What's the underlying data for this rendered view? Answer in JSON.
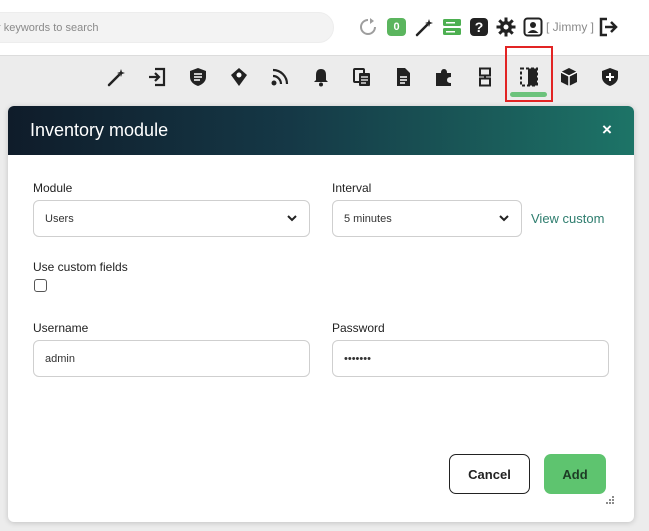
{
  "header": {
    "search_placeholder": "r keywords to search",
    "notification_count": "0",
    "user_name": "[ Jimmy ]",
    "icons": [
      "refresh-icon",
      "magic-wand-icon",
      "server-icon",
      "help-icon",
      "gear-icon",
      "user-icon",
      "logout-icon"
    ]
  },
  "toolbar": {
    "icons": [
      "magic-wand-icon",
      "sign-in-icon",
      "shield-icon",
      "map-marker-icon",
      "wifi-icon",
      "bell-icon",
      "copy-icon",
      "file-icon",
      "puzzle-icon",
      "component-icon",
      "book-icon",
      "box-icon",
      "shield-plus-icon"
    ],
    "active_icon": "book-icon"
  },
  "modal": {
    "title": "Inventory module",
    "close_label": "×",
    "module_label": "Module",
    "module_value": "Users",
    "interval_label": "Interval",
    "interval_value": "5 minutes",
    "view_custom_label": "View custom",
    "custom_fields_label": "Use custom fields",
    "custom_fields_checked": false,
    "username_label": "Username",
    "username_value": "admin",
    "password_label": "Password",
    "password_value": "•••••••",
    "cancel_label": "Cancel",
    "add_label": "Add"
  },
  "colors": {
    "accent_green": "#5ec46f",
    "header_gradient_start": "#0f1c2a",
    "header_gradient_end": "#1d7467",
    "highlight_red": "#e22424",
    "link_teal": "#2e7d6e"
  }
}
